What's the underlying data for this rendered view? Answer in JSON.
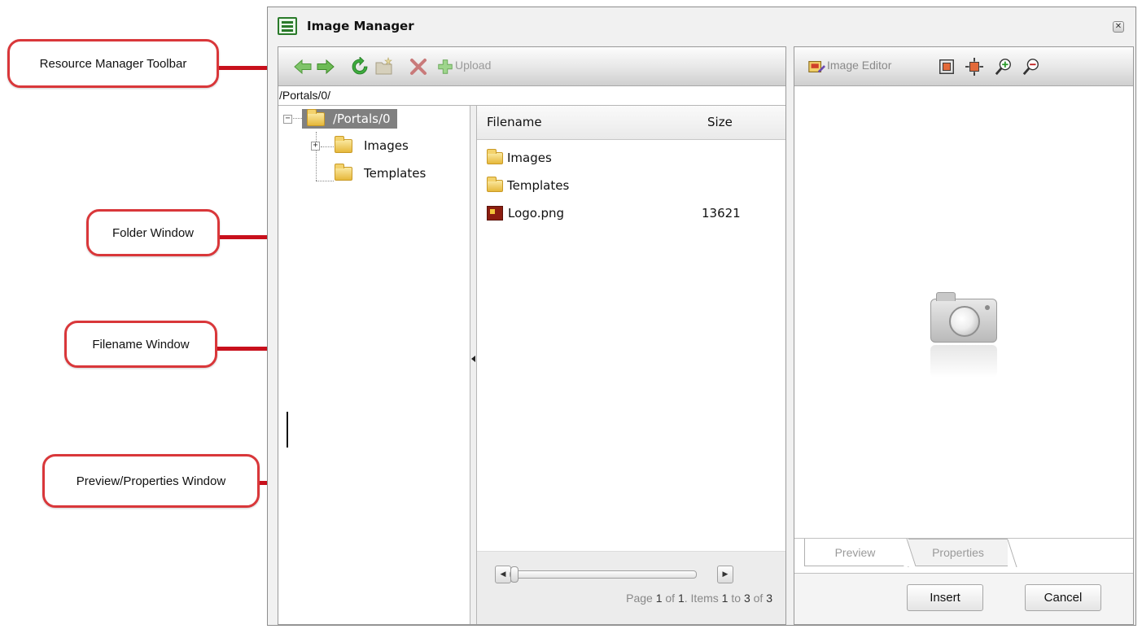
{
  "callouts": {
    "toolbar": "Resource Manager Toolbar",
    "folder_window": "Folder Window",
    "filename_window": "Filename Window",
    "preview_window": "Preview/Properties Window"
  },
  "dialog": {
    "title": "Image Manager",
    "close_glyph": "✕"
  },
  "resource_toolbar": {
    "upload_label": "Upload",
    "icons": [
      "back-arrow-icon",
      "forward-arrow-icon",
      "refresh-icon",
      "new-folder-icon",
      "delete-icon",
      "add-icon"
    ]
  },
  "path": "/Portals/0/",
  "folder_tree": {
    "root": "/Portals/0",
    "children": [
      {
        "label": "Images",
        "expandable": true
      },
      {
        "label": "Templates",
        "expandable": false
      }
    ]
  },
  "file_list": {
    "columns": [
      "Filename",
      "Size"
    ],
    "rows": [
      {
        "name": "Images",
        "size": "",
        "type": "folder"
      },
      {
        "name": "Templates",
        "size": "",
        "type": "folder"
      },
      {
        "name": "Logo.png",
        "size": "13621",
        "type": "image"
      }
    ]
  },
  "pager": {
    "prefix": "Page",
    "page": "1",
    "of_word": "of",
    "pages": "1",
    "items_word": ". Items",
    "from": "1",
    "to_word": "to",
    "to": "3",
    "total_word": "of",
    "total": "3"
  },
  "preview_toolbar": {
    "image_editor_label": "Image Editor",
    "icons": [
      "image-editor-icon",
      "best-fit-icon",
      "actual-size-icon",
      "zoom-in-icon",
      "zoom-out-icon"
    ]
  },
  "tabs": [
    "Preview",
    "Properties"
  ],
  "buttons": {
    "insert": "Insert",
    "cancel": "Cancel"
  },
  "colors": {
    "callout_border": "#d9373a",
    "leader_red": "#c8101c",
    "selected_node": "#808080"
  }
}
